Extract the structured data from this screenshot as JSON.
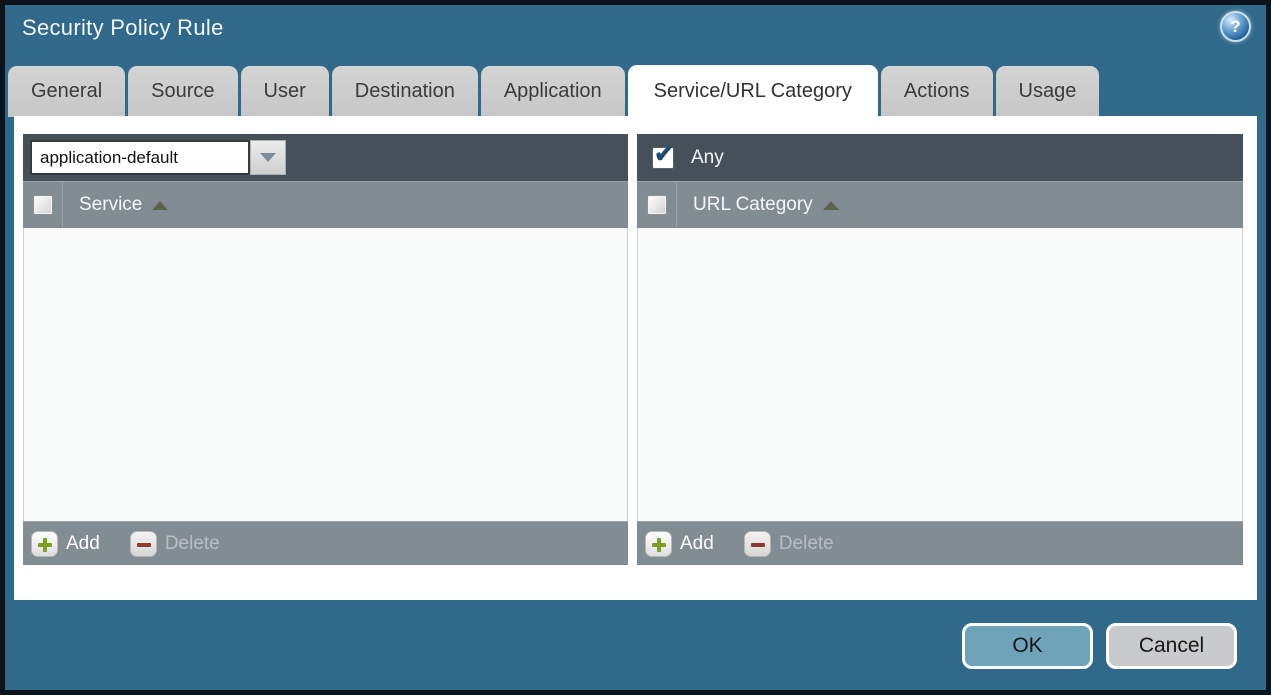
{
  "window": {
    "title": "Security Policy Rule"
  },
  "icons": {
    "help_glyph": "?",
    "check_glyph": "✔"
  },
  "tabs": [
    {
      "label": "General",
      "active": false
    },
    {
      "label": "Source",
      "active": false
    },
    {
      "label": "User",
      "active": false
    },
    {
      "label": "Destination",
      "active": false
    },
    {
      "label": "Application",
      "active": false
    },
    {
      "label": "Service/URL Category",
      "active": true
    },
    {
      "label": "Actions",
      "active": false
    },
    {
      "label": "Usage",
      "active": false
    }
  ],
  "service_panel": {
    "dropdown_value": "application-default",
    "column_header": "Service",
    "header_checkbox_checked": false,
    "rows": [],
    "add_label": "Add",
    "delete_label": "Delete",
    "delete_enabled": false
  },
  "url_category_panel": {
    "any_label": "Any",
    "any_checked": true,
    "column_header": "URL Category",
    "header_checkbox_checked": false,
    "rows": [],
    "add_label": "Add",
    "delete_label": "Delete",
    "delete_enabled": false
  },
  "footer_buttons": {
    "ok": "OK",
    "cancel": "Cancel"
  },
  "colors": {
    "background_teal": "#31698a",
    "outer_frame": "#0b141c",
    "toolbar_dark": "#45505a",
    "grid_header_gray": "#828d93",
    "grid_body": "#fafbfb",
    "ok_button": "#6fa3ba",
    "cancel_button": "#c9cacc",
    "add_icon_green": "#7f9d23",
    "delete_icon_red": "#8c3b2c",
    "any_check_navy": "#1e4a6d"
  }
}
